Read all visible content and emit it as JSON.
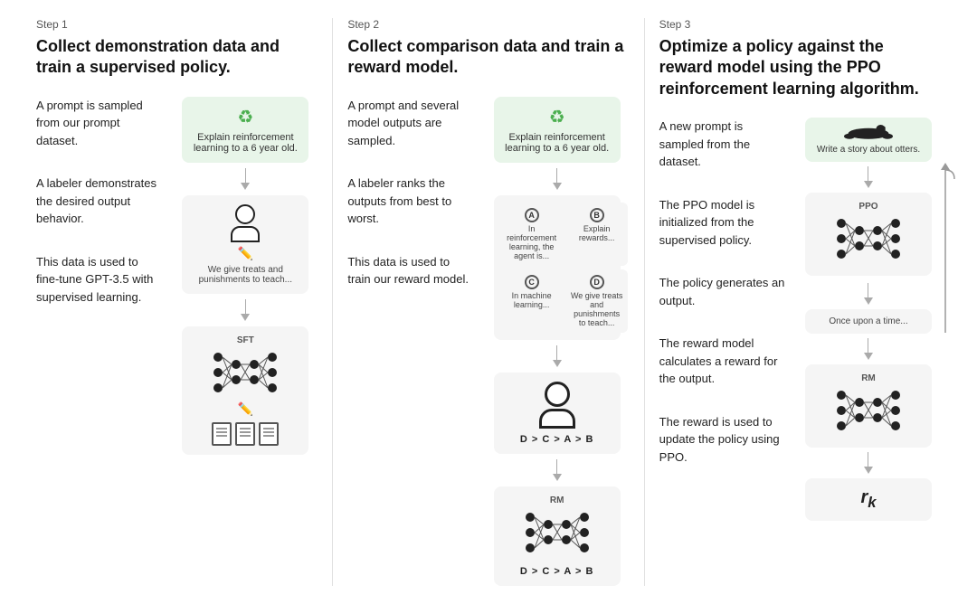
{
  "steps": [
    {
      "id": "step1",
      "label": "Step 1",
      "title": "Collect demonstration data and train a supervised policy.",
      "texts": [
        "A prompt is sampled from our prompt dataset.",
        "A labeler demonstrates the desired output behavior.",
        "This data is used to fine-tune GPT-3.5 with supervised learning."
      ],
      "prompt_text": "Explain reinforcement learning to a 6 year old.",
      "labeler_text": "We give treats and punishments to teach...",
      "nn_label": "SFT"
    },
    {
      "id": "step2",
      "label": "Step 2",
      "title": "Collect comparison data and train a reward model.",
      "texts": [
        "A prompt and several model outputs are sampled.",
        "A labeler ranks the outputs from best to worst.",
        "This data is used to train our reward model."
      ],
      "prompt_text": "Explain reinforcement learning to a 6 year old.",
      "options": [
        {
          "letter": "A",
          "text": "In reinforcement learning, the agent is..."
        },
        {
          "letter": "B",
          "text": "Explain rewards..."
        },
        {
          "letter": "C",
          "text": "In machine learning..."
        },
        {
          "letter": "D",
          "text": "We give treats and punishments to teach..."
        }
      ],
      "ranking": "D > C > A > B",
      "rm_label": "RM",
      "rm_ranking": "D > C > A > B"
    },
    {
      "id": "step3",
      "label": "Step 3",
      "title": "Optimize a policy against the reward model using the PPO reinforcement learning algorithm.",
      "texts": [
        "A new prompt is sampled from the dataset.",
        "The PPO model is initialized from the supervised policy.",
        "The policy generates an output.",
        "The reward model calculates a reward for the output.",
        "The reward is used to update the policy using PPO."
      ],
      "prompt_text": "Write a story about otters.",
      "ppo_label": "PPO",
      "output_text": "Once upon a time...",
      "rm_label": "RM",
      "reward_val": "r k"
    }
  ]
}
